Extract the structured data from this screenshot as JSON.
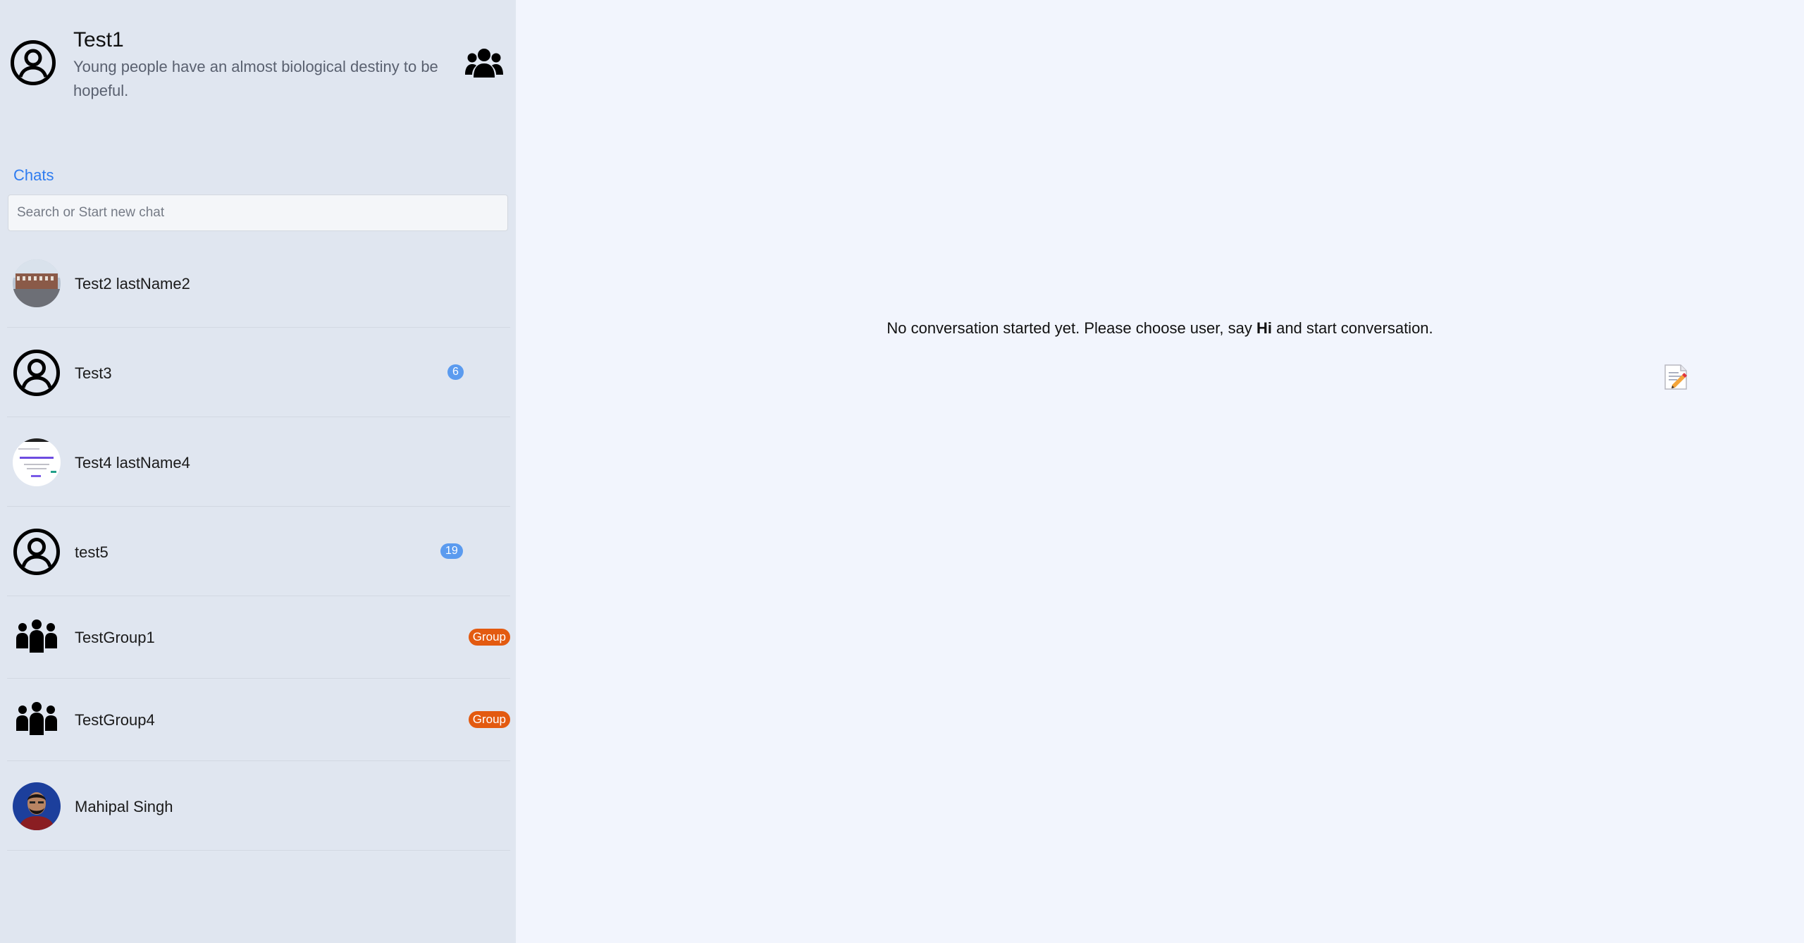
{
  "profile": {
    "name": "Test1",
    "status": "Young people have an almost biological destiny to be hopeful."
  },
  "sidebar": {
    "chats_heading": "Chats",
    "search_placeholder": "Search or Start new chat"
  },
  "chats": [
    {
      "name": "Test2 lastName2",
      "avatar": "photo-building",
      "badge": ""
    },
    {
      "name": "Test3",
      "avatar": "user-circle-icon",
      "badge": "6"
    },
    {
      "name": "Test4 lastName4",
      "avatar": "photo-screenshot",
      "badge": ""
    },
    {
      "name": "test5",
      "avatar": "user-circle-icon",
      "badge": "19"
    },
    {
      "name": "TestGroup1",
      "avatar": "group-icon",
      "badge": "Group"
    },
    {
      "name": "TestGroup4",
      "avatar": "group-icon",
      "badge": "Group"
    },
    {
      "name": "Mahipal Singh",
      "avatar": "photo-person",
      "badge": ""
    }
  ],
  "main": {
    "empty_prefix": "No conversation started yet. Please choose user, say ",
    "empty_bold": "Hi",
    "empty_suffix": " and start conversation.",
    "empty_icon": "memo-icon"
  },
  "colors": {
    "sidebar_bg": "#e0e6f0",
    "main_bg": "#f2f5fd",
    "accent": "#2f7cf0",
    "count_badge": "#5b9bef",
    "group_badge": "#e35a10"
  }
}
